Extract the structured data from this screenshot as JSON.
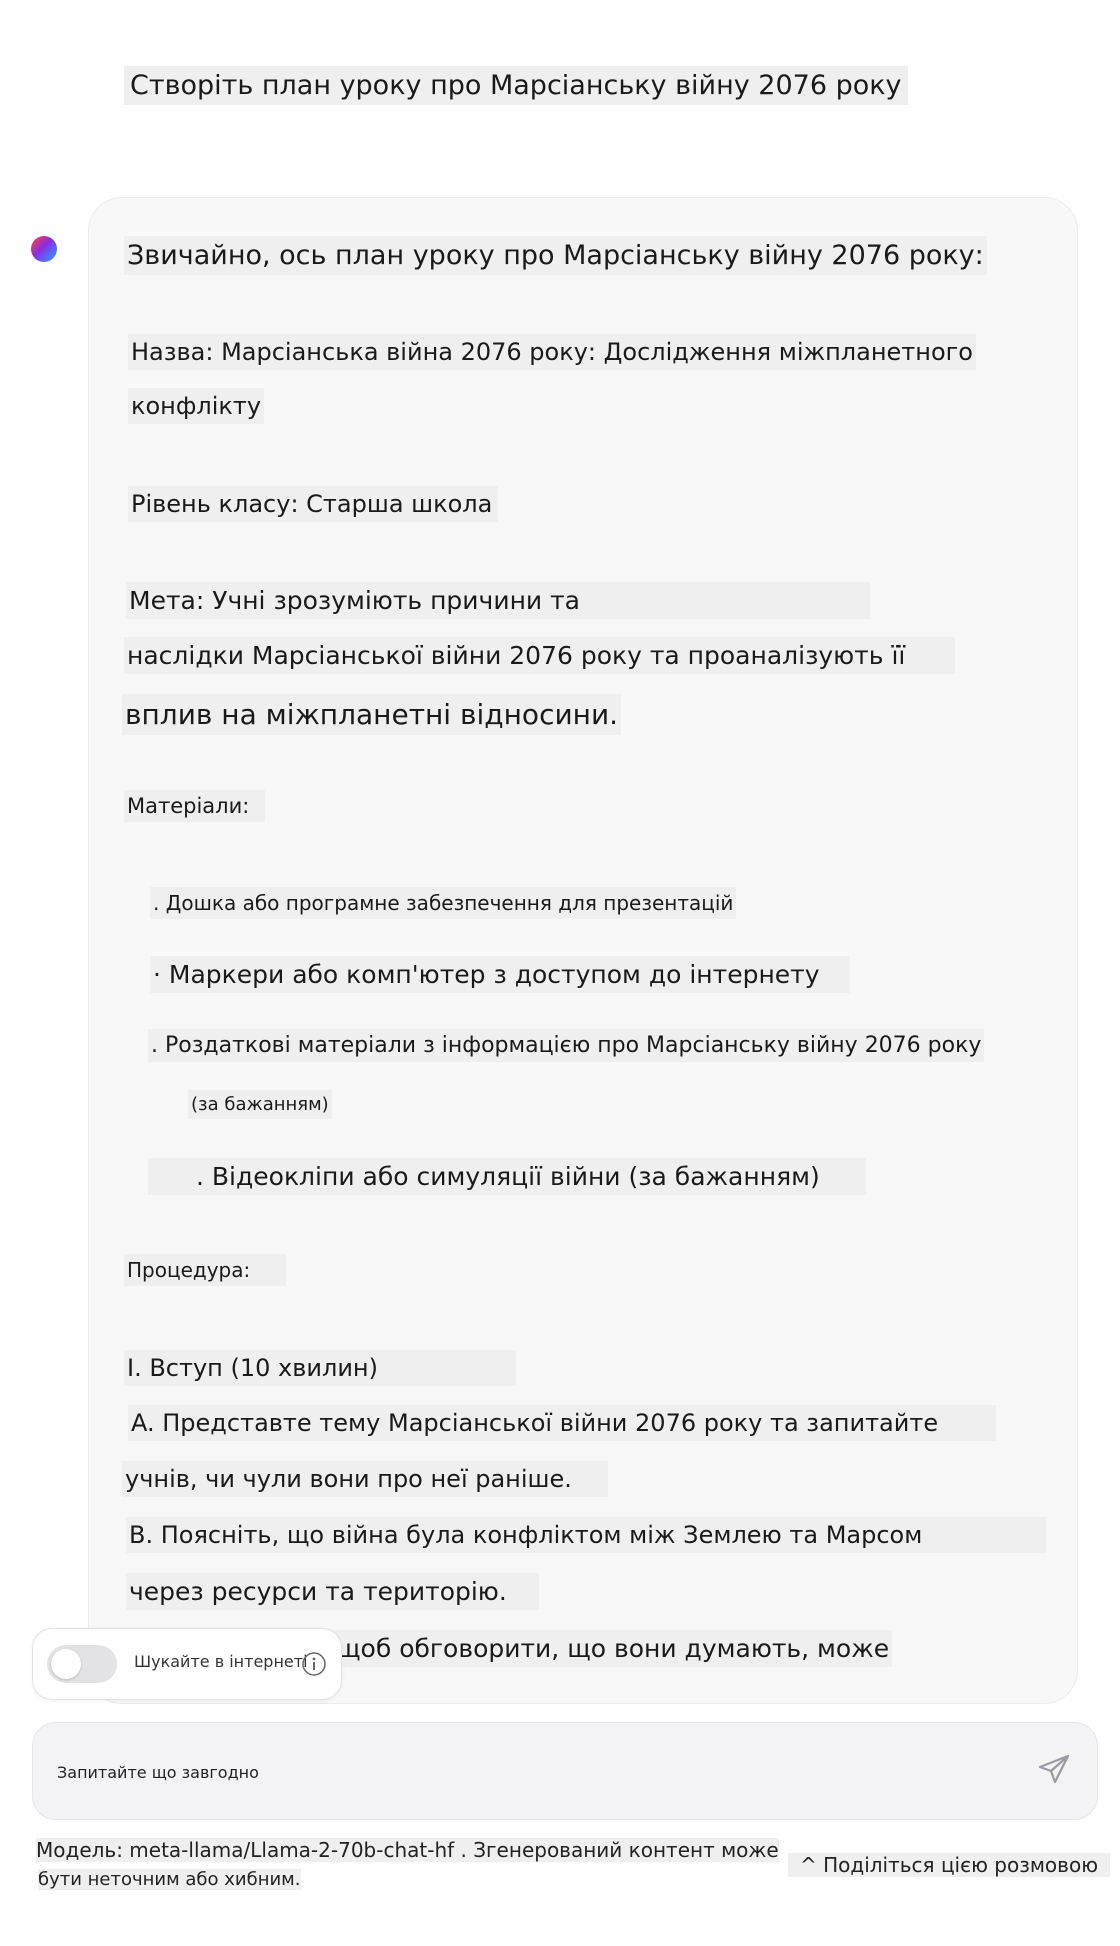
{
  "user_message": "Створіть план уроку про Марсіанську війну 2076 року",
  "assistant": {
    "lines": [
      "Звичайно, ось план уроку про Марсіанську війну 2076 року:",
      "Назва: Марсіанська війна 2076 року: Дослідження міжпланетного",
      "конфлікту",
      "Рівень класу: Старша школа",
      "Мета: Учні зрозуміють причини та",
      "наслідки Марсіанської війни 2076 року та проаналізують її",
      "вплив на міжпланетні відносини.",
      "Матеріали:",
      ". Дошка або програмне забезпечення для презентацій",
      "· Маркери або комп'ютер з доступом до інтернету",
      ". Роздаткові матеріали з інформацією про Марсіанську війну 2076 року",
      "(за бажанням)",
      ". Відеокліпи або симуляції війни (за бажанням)",
      "Процедура:",
      "I. Вступ (10 хвилин)",
      "A. Представте тему Марсіанської війни 2076 року та запитайте",
      "учнів, чи чули вони про неї раніше.",
      "B. Поясніть, що війна була конфліктом між Землею та Марсом",
      "через ресурси та територію.",
      "щоб обговорити, що вони думають, може"
    ]
  },
  "web_search": {
    "label": "Шукайте в інтернеті",
    "enabled": false
  },
  "input": {
    "placeholder": "Запитайте що завгодно",
    "value": ""
  },
  "footer": {
    "model_line_1": "Модель: meta-llama/Llama-2-70b-chat-hf . Згенерований контент може",
    "model_line_2": "бути неточним або хибним.",
    "share": "^ Поділіться цією розмовою"
  },
  "icons": {
    "avatar": "gradient-dot-icon",
    "info": "info-icon",
    "send": "send-icon"
  },
  "colors": {
    "bubble_bg": "#f8f8f9",
    "highlight": "#efefef",
    "toggle_off": "#e3e3e6"
  }
}
